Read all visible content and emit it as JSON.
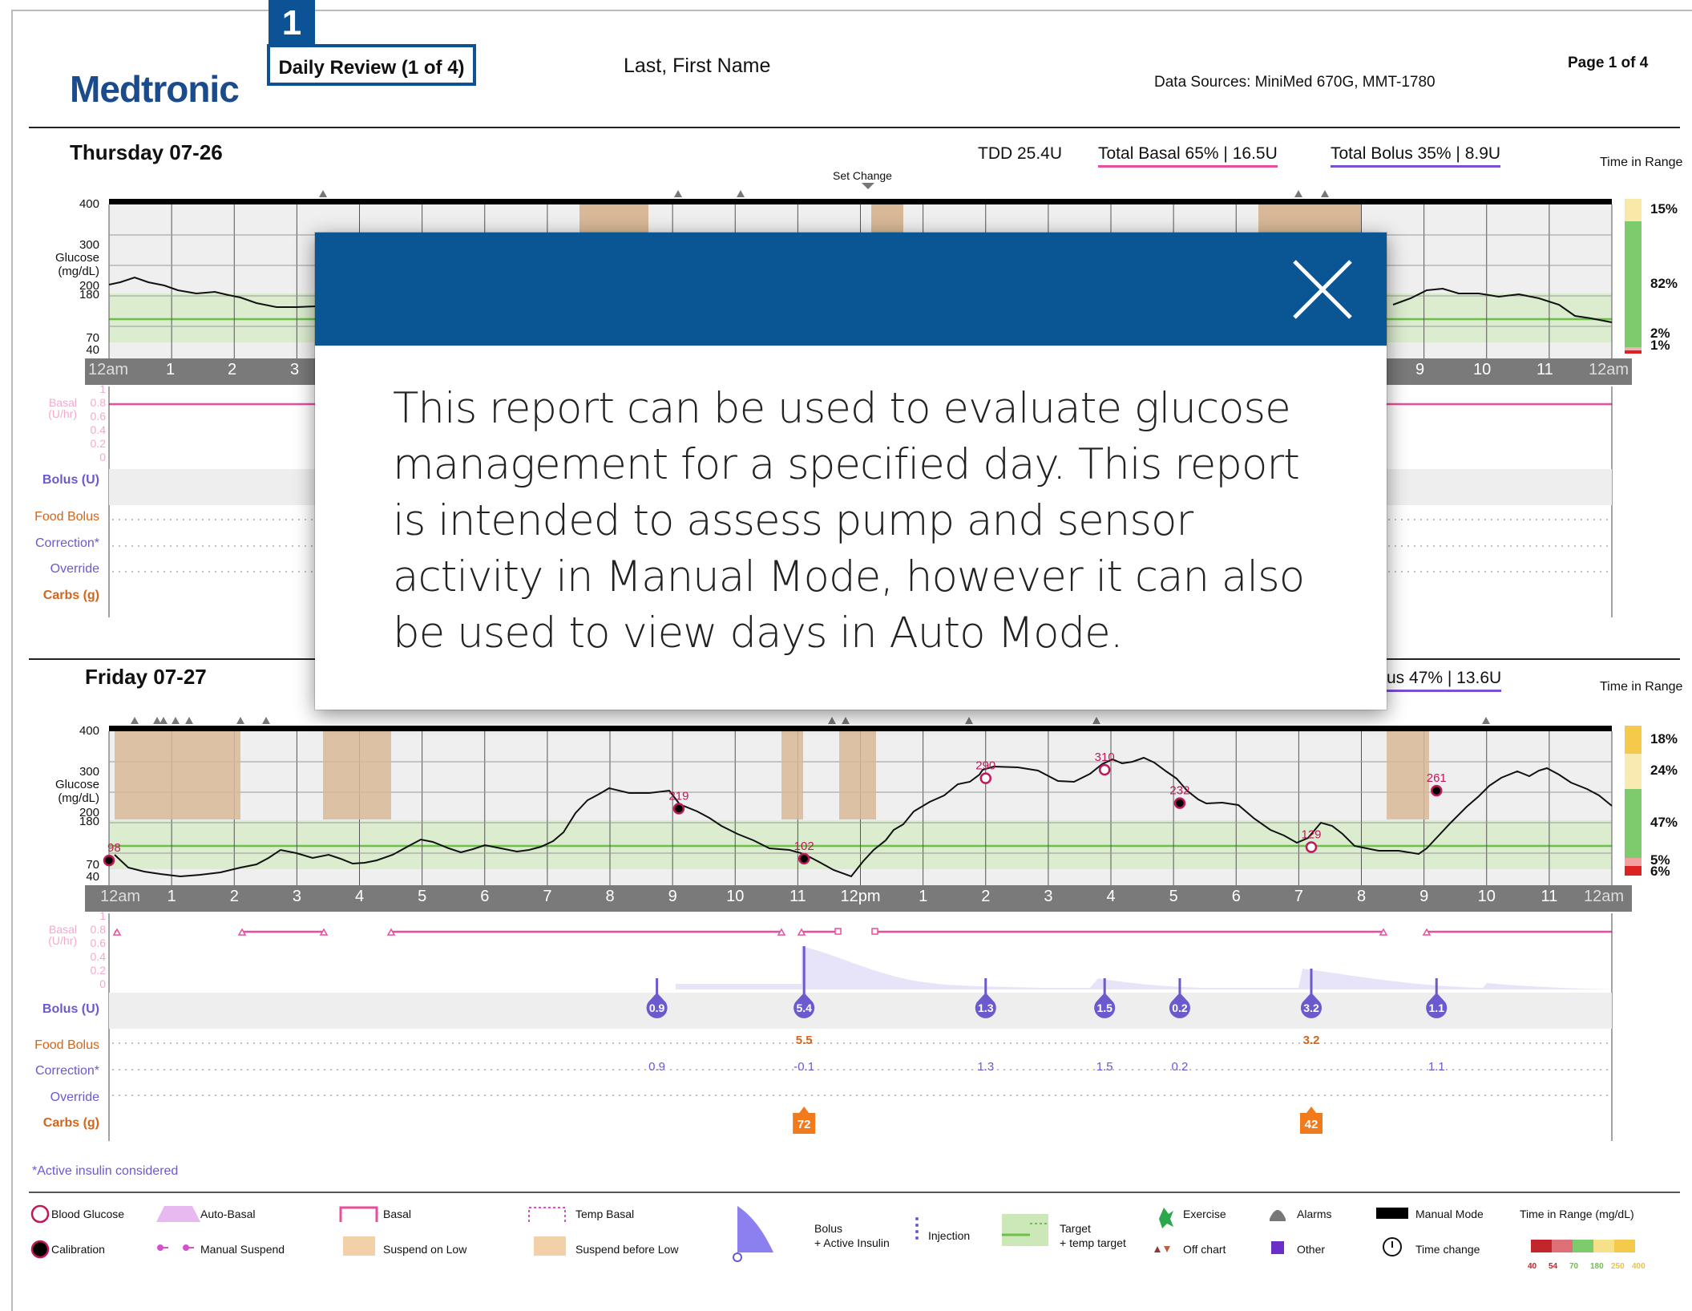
{
  "header": {
    "brand": "Medtronic",
    "badge_number": "1",
    "report_title": "Daily Review (1 of 4)",
    "patient_name": "Last, First Name",
    "data_sources": "Data Sources: MiniMed 670G, MMT-1780",
    "page": "Page 1 of 4"
  },
  "day1": {
    "title": "Thursday 07-26",
    "tdd": "TDD 25.4U",
    "total_basal": "Total Basal 65% | 16.5U",
    "total_bolus": "Total Bolus 35% | 8.9U",
    "time_in_range_label": "Time in Range",
    "set_change": "Set Change",
    "tir": [
      "15%",
      "82%",
      "2%",
      "1%"
    ],
    "glucose_ticks": [
      "400",
      "300",
      "200",
      "180",
      "70",
      "40"
    ],
    "hours": [
      "12am",
      "1",
      "2",
      "3",
      "9",
      "10",
      "11",
      "12am"
    ]
  },
  "day2": {
    "title": "Friday 07-27",
    "total_bolus_partial": "us 47% | 13.6U",
    "time_in_range_label": "Time in Range",
    "tir": [
      "18%",
      "24%",
      "47%",
      "5%",
      "6%"
    ],
    "glucose_ticks": [
      "400",
      "300",
      "200",
      "180",
      "70",
      "40"
    ],
    "hours": [
      "12am",
      "1",
      "2",
      "3",
      "4",
      "5",
      "6",
      "7",
      "8",
      "9",
      "10",
      "11",
      "12pm",
      "1",
      "2",
      "3",
      "4",
      "5",
      "6",
      "7",
      "8",
      "9",
      "10",
      "11",
      "12am"
    ],
    "bg_readings": [
      "98",
      "219",
      "102",
      "290",
      "310",
      "232",
      "129",
      "261"
    ],
    "boluses": [
      "0.9",
      "5.4",
      "1.3",
      "1.5",
      "0.2",
      "3.2",
      "1.1"
    ],
    "food_bolus": [
      "5.5",
      "3.2"
    ],
    "correction": [
      "0.9",
      "-0.1",
      "1.3",
      "1.5",
      "0.2",
      "1.1"
    ],
    "carbs": [
      "72",
      "42"
    ]
  },
  "axis": {
    "glucose_label_1": "Glucose",
    "glucose_label_2": "(mg/dL)",
    "basal_label_1": "Basal",
    "basal_label_2": "(U/hr)",
    "basal_ticks": [
      "1",
      "0.8",
      "0.6",
      "0.4",
      "0.2",
      "0"
    ],
    "bolus_label": "Bolus (U)",
    "food_bolus_label": "Food Bolus",
    "correction_label": "Correction*",
    "override_label": "Override",
    "carbs_label": "Carbs (g)"
  },
  "footnote": "*Active insulin considered",
  "legend": {
    "blood_glucose": "Blood Glucose",
    "calibration": "Calibration",
    "auto_basal": "Auto-Basal",
    "manual_suspend": "Manual Suspend",
    "basal": "Basal",
    "suspend_on_low": "Suspend on Low",
    "temp_basal": "Temp Basal",
    "suspend_before_low": "Suspend before Low",
    "bolus": "Bolus",
    "active_insulin": "+ Active Insulin",
    "injection": "Injection",
    "target": "Target",
    "temp_target": "+ temp target",
    "exercise": "Exercise",
    "off_chart": "Off chart",
    "alarms": "Alarms",
    "other": "Other",
    "manual_mode": "Manual Mode",
    "time_change": "Time change",
    "tir_title": "Time in Range (mg/dL)",
    "tir_ticks": [
      "40",
      "54",
      "70",
      "180",
      "250",
      "400"
    ]
  },
  "modal": {
    "message": "This report can be used to evaluate glucose management for a specified day. This report is intended to assess pump and sensor activity in Manual Mode, however it can also be used to view days in Auto Mode.",
    "close_icon": "close-icon"
  },
  "colors": {
    "brand_blue": "#0a5593",
    "range_green": "#6cc04a",
    "basal_pink": "#e84f9b",
    "bolus_purple": "#6a5acd",
    "carbs_orange": "#f07a1c"
  }
}
